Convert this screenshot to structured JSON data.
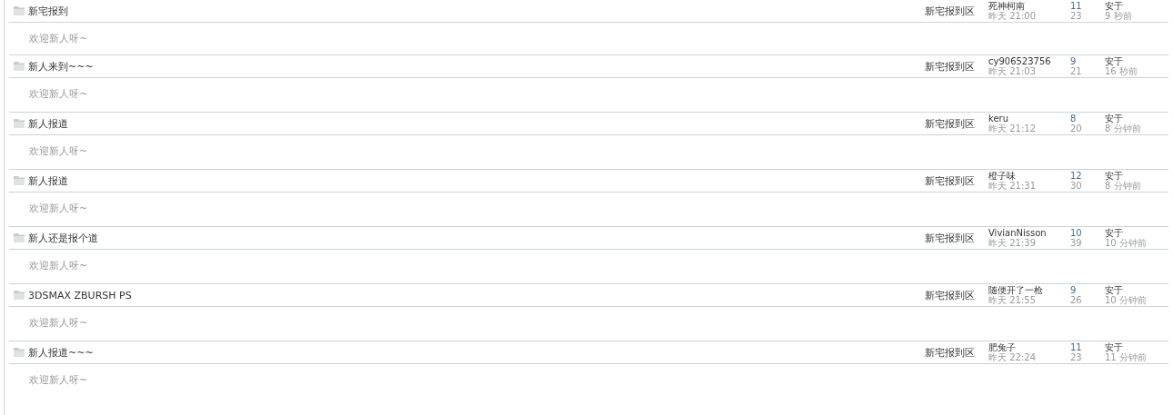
{
  "threads": [
    {
      "title": "新宅报到",
      "excerpt": "欢迎新人呀~",
      "forum": "新宅报到区",
      "author": "死神柯南",
      "date": "昨天 21:00",
      "replies": "11",
      "views": "23",
      "last_poster": "安于",
      "last_time": "9 秒前"
    },
    {
      "title": "新人来到~~~",
      "excerpt": "欢迎新人呀~",
      "forum": "新宅报到区",
      "author": "cy906523756",
      "date": "昨天 21:03",
      "replies": "9",
      "views": "21",
      "last_poster": "安于",
      "last_time": "16 秒前"
    },
    {
      "title": "新人报道",
      "excerpt": "欢迎新人呀~",
      "forum": "新宅报到区",
      "author": "keru",
      "date": "昨天 21:12",
      "replies": "8",
      "views": "20",
      "last_poster": "安于",
      "last_time": "8 分钟前"
    },
    {
      "title": "新人报道",
      "excerpt": "欢迎新人呀~",
      "forum": "新宅报到区",
      "author": "橙子味",
      "date": "昨天 21:31",
      "replies": "12",
      "views": "30",
      "last_poster": "安于",
      "last_time": "8 分钟前"
    },
    {
      "title": "新人还是报个道",
      "excerpt": "欢迎新人呀~",
      "forum": "新宅报到区",
      "author": "VivianNisson",
      "date": "昨天 21:39",
      "replies": "10",
      "views": "39",
      "last_poster": "安于",
      "last_time": "10 分钟前"
    },
    {
      "title": "3DSMAX ZBURSH PS",
      "excerpt": "欢迎新人呀~",
      "forum": "新宅报到区",
      "author": "随便开了一枪",
      "date": "昨天 21:55",
      "replies": "9",
      "views": "26",
      "last_poster": "安于",
      "last_time": "10 分钟前"
    },
    {
      "title": "新人报道~~~",
      "excerpt": "欢迎新人呀~",
      "forum": "新宅报到区",
      "author": "肥兔子",
      "date": "昨天 22:24",
      "replies": "11",
      "views": "23",
      "last_poster": "安于",
      "last_time": "11 分钟前"
    }
  ]
}
